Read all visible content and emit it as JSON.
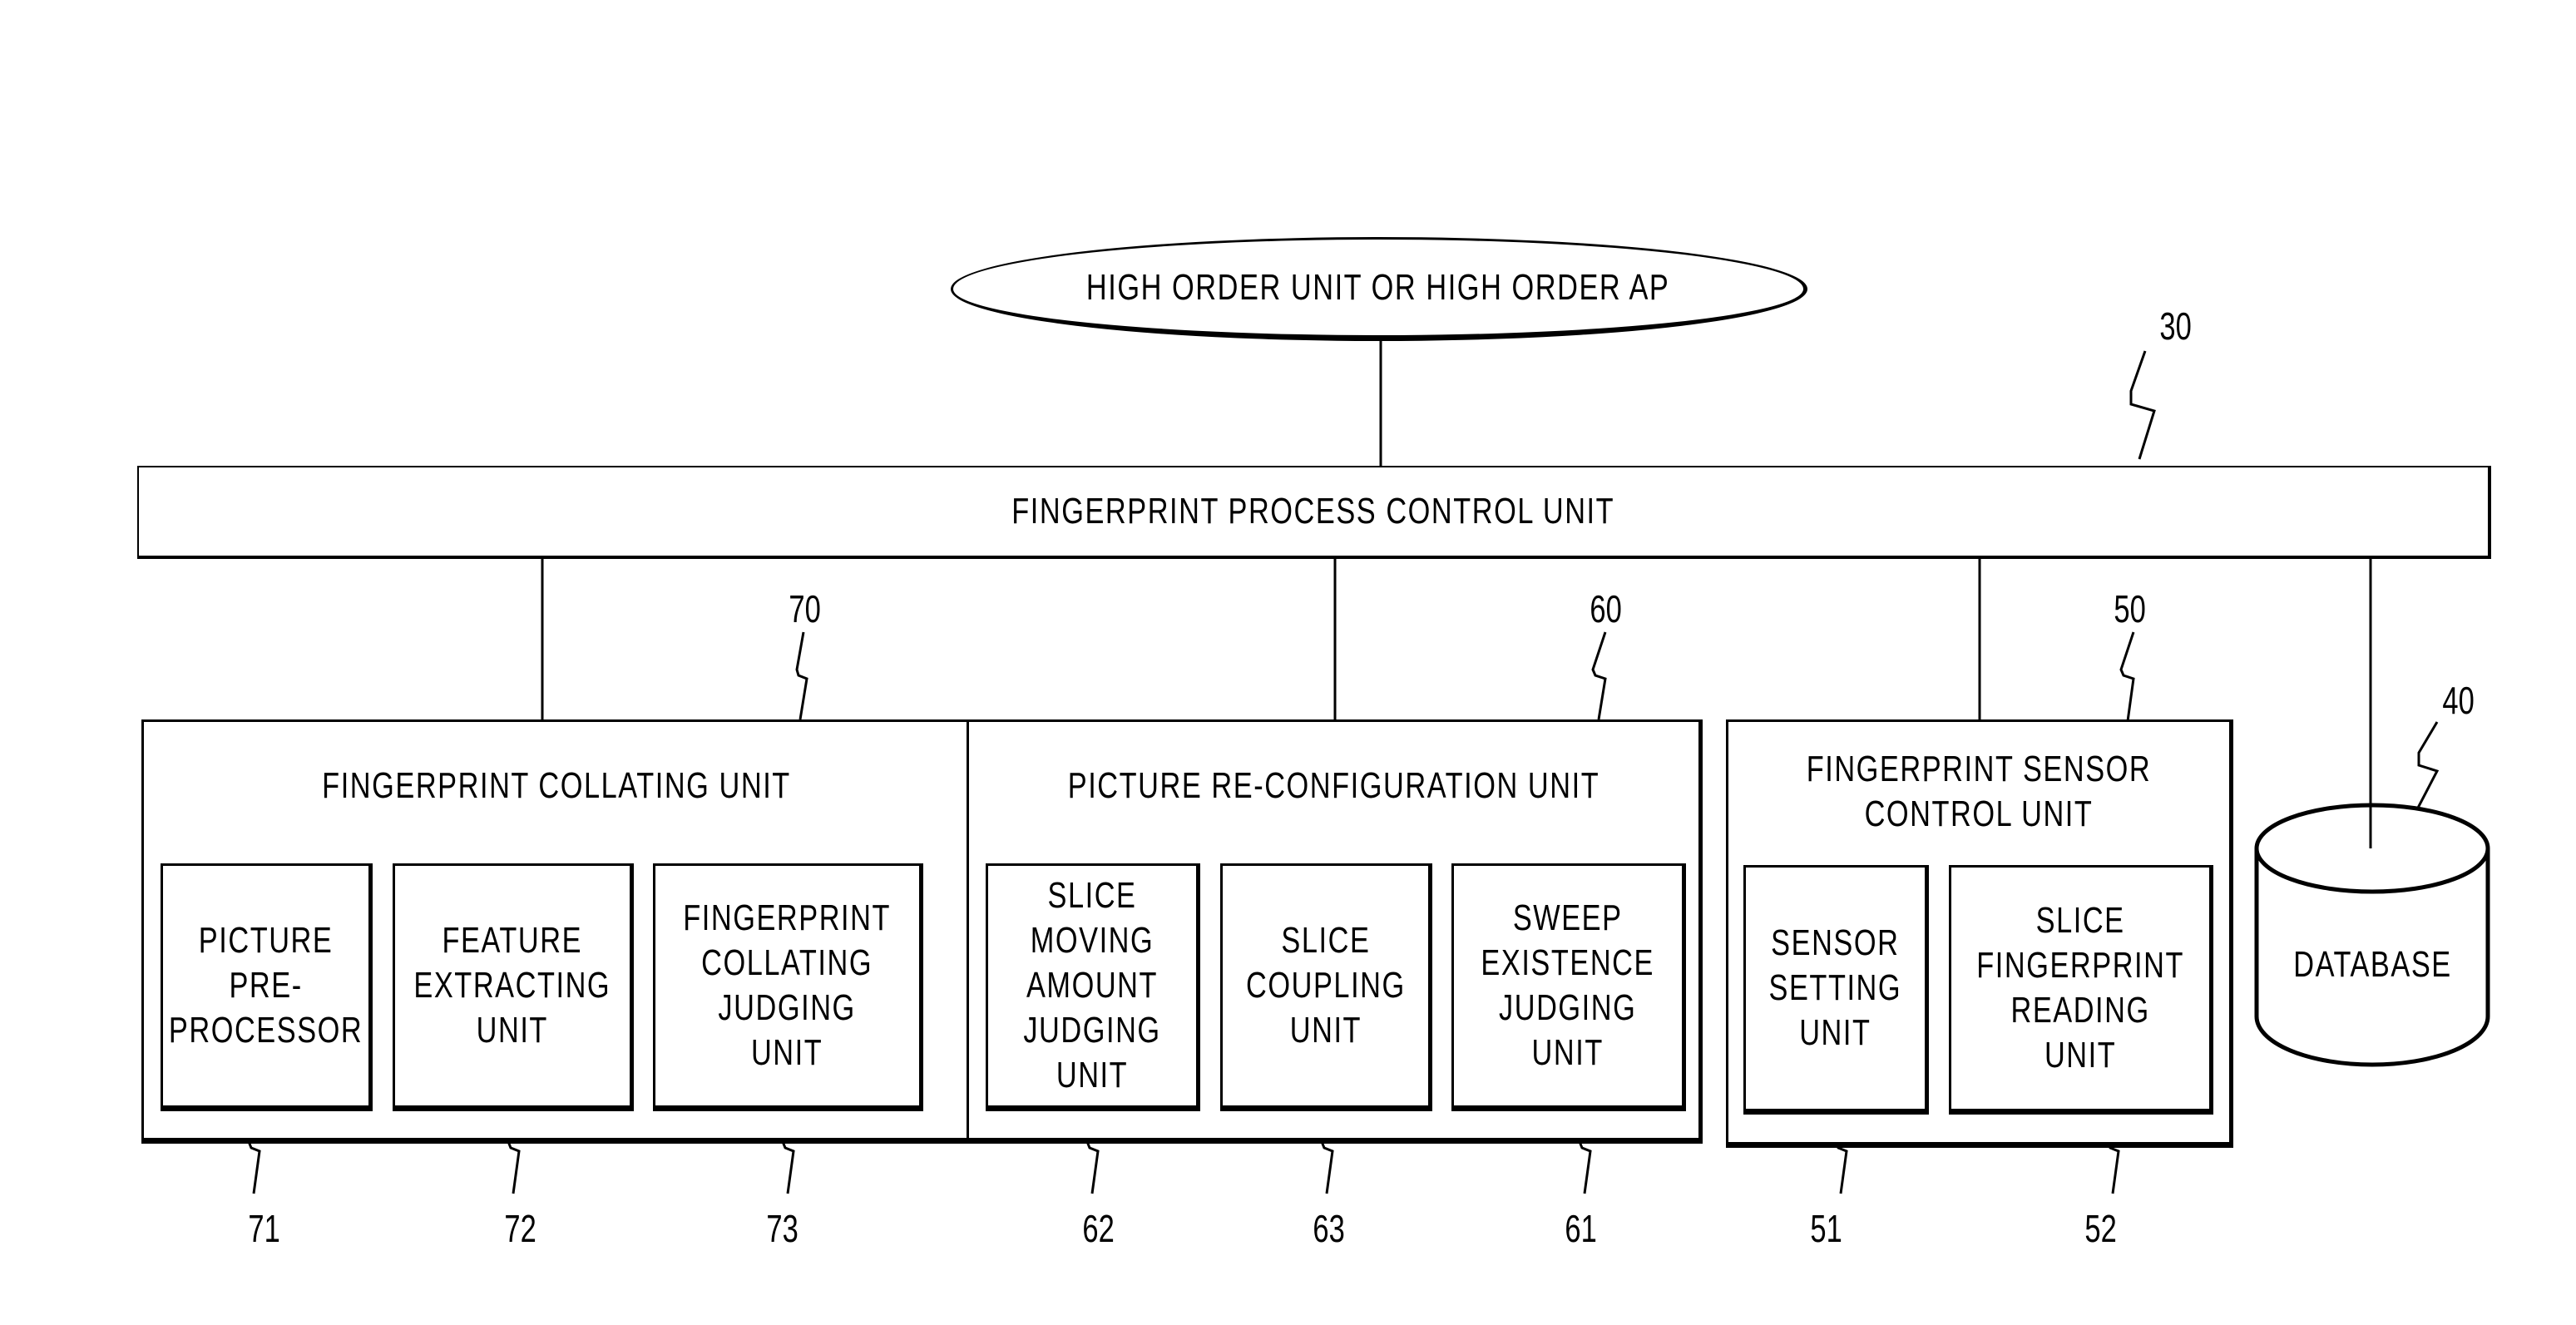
{
  "diagram": {
    "high_order": "HIGH ORDER UNIT OR HIGH ORDER AP",
    "process_control": {
      "label": "FINGERPRINT PROCESS CONTROL UNIT",
      "ref": "30"
    },
    "database": {
      "label": "DATABASE",
      "ref": "40"
    },
    "collating_unit": {
      "label": "FINGERPRINT COLLATING UNIT",
      "ref": "70",
      "children": [
        {
          "label": "PICTURE\nPRE-\nPROCESSOR",
          "ref": "71"
        },
        {
          "label": "FEATURE\nEXTRACTING\nUNIT",
          "ref": "72"
        },
        {
          "label": "FINGERPRINT\nCOLLATING\nJUDGING UNIT",
          "ref": "73"
        }
      ]
    },
    "reconfig_unit": {
      "label": "PICTURE RE-CONFIGURATION UNIT",
      "ref": "60",
      "children": [
        {
          "label": "SLICE\nMOVING\nAMOUNT\nJUDGING\nUNIT",
          "ref": "62"
        },
        {
          "label": "SLICE\nCOUPLING\nUNIT",
          "ref": "63"
        },
        {
          "label": "SWEEP\nEXISTENCE\nJUDGING\nUNIT",
          "ref": "61"
        }
      ]
    },
    "sensor_unit": {
      "label": "FINGERPRINT SENSOR\nCONTROL UNIT",
      "ref": "50",
      "children": [
        {
          "label": "SENSOR\nSETTING\nUNIT",
          "ref": "51"
        },
        {
          "label": "SLICE\nFINGERPRINT\nREADING\nUNIT",
          "ref": "52"
        }
      ]
    }
  }
}
